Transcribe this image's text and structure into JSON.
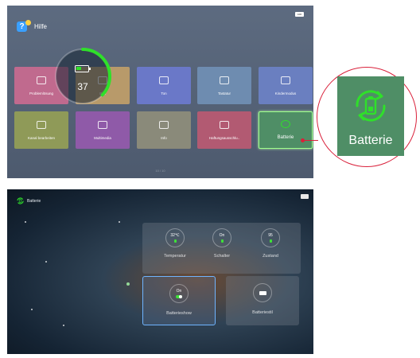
{
  "help_screen": {
    "title": "Hilfe",
    "battery_badge": "100",
    "tiles": [
      {
        "label": "Problemlösung",
        "color": "#c06a8e",
        "icon": "question-icon"
      },
      {
        "label": "Bild",
        "color": "#b89a6a",
        "icon": "image-icon"
      },
      {
        "label": "Ton",
        "color": "#6a78c8",
        "icon": "speaker-icon"
      },
      {
        "label": "Tastatur",
        "color": "#6e8cb0",
        "icon": "keyboard-icon"
      },
      {
        "label": "Kindermodus",
        "color": "#6a7fc0",
        "icon": "smiley-icon"
      },
      {
        "label": "Kanal bearbeiten",
        "color": "#8f9a58",
        "icon": "tv-icon"
      },
      {
        "label": "Multimedia",
        "color": "#8f5aa8",
        "icon": "multimedia-icon"
      },
      {
        "label": "Info",
        "color": "#8a8a7a",
        "icon": "info-icon"
      },
      {
        "label": "Haftungsausschlu..",
        "color": "#b25a72",
        "icon": "disclaimer-icon"
      },
      {
        "label": "Batterie",
        "color": "#4f8e66",
        "icon": "battery-refresh-icon",
        "selected": true
      }
    ],
    "pager": "10 / 10"
  },
  "zoom": {
    "label": "Batterie",
    "icon": "battery-refresh-icon",
    "accent": "#2fe02a",
    "callout_color": "#d9203a"
  },
  "battery_screen": {
    "title": "Batterie",
    "level": 37,
    "level_fraction": 0.37,
    "accent": "#2fe02a",
    "cards": [
      {
        "value": "32℃",
        "label": "Temperatur"
      },
      {
        "value": "On",
        "label": "Schalter"
      },
      {
        "value": "95",
        "label": "Zustand"
      }
    ],
    "big_cards": [
      {
        "value": "On",
        "label": "Batterieshow",
        "selected": true
      },
      {
        "value": "",
        "label": "Batteriestil"
      }
    ]
  }
}
